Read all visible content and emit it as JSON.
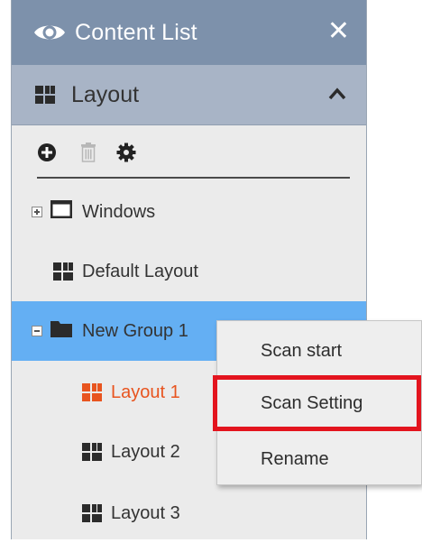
{
  "panel": {
    "title": "Content List",
    "close_glyph": "✕"
  },
  "section": {
    "label": "Layout"
  },
  "toolbar": {
    "add_icon": "add-circle-icon",
    "delete_icon": "trash-icon",
    "settings_icon": "gear-icon"
  },
  "tree": {
    "windows": {
      "label": "Windows",
      "expander": "+"
    },
    "default_layout": {
      "label": "Default Layout"
    },
    "new_group": {
      "label": "New Group 1",
      "expander": "-"
    },
    "layout1": {
      "label": "Layout 1"
    },
    "layout2": {
      "label": "Layout 2"
    },
    "layout3": {
      "label": "Layout 3"
    }
  },
  "context_menu": {
    "scan_start": "Scan start",
    "scan_setting": "Scan Setting",
    "rename": "Rename"
  },
  "colors": {
    "title_bar": "#7d91ab",
    "section_bar": "#a8b4c6",
    "panel_bg": "#ebebeb",
    "selection": "#64aff3",
    "active_item": "#e8541f",
    "highlight_box": "#e3141e"
  }
}
